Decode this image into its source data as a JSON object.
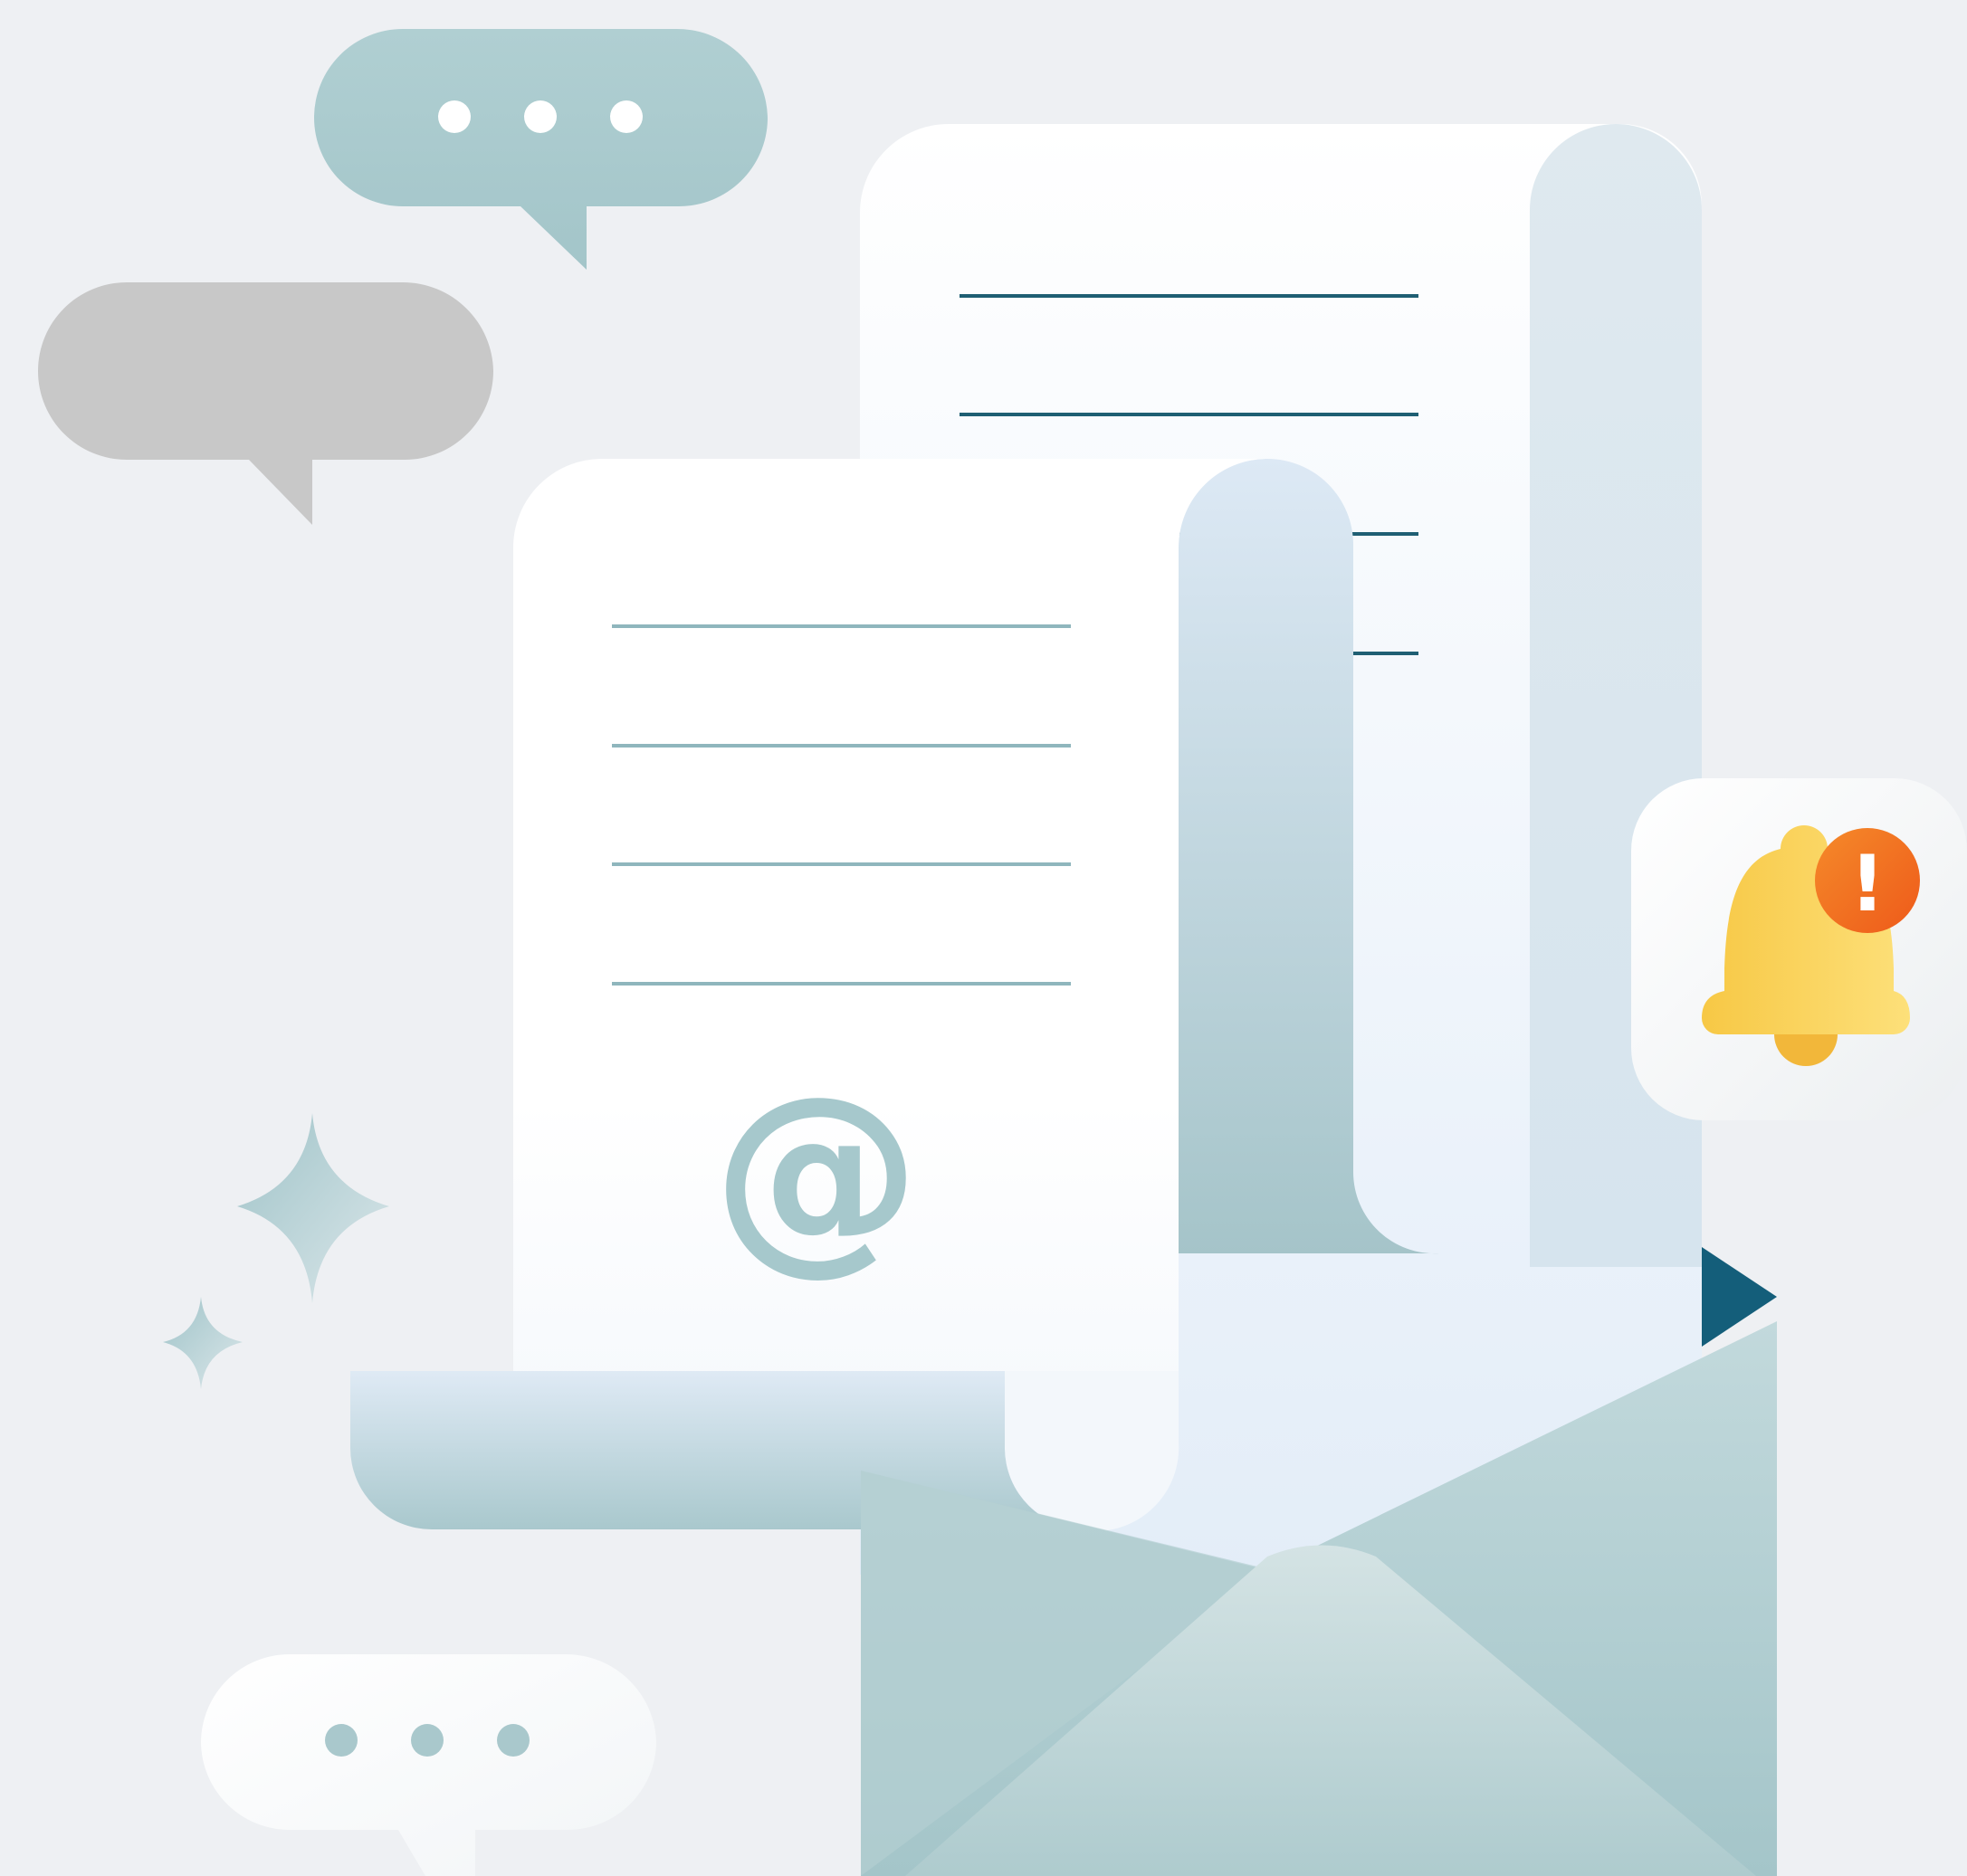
{
  "illustration": {
    "envelope_symbol": "@",
    "alert_symbol": "!",
    "icons": {
      "chat_bubble_top": "chat-bubble-typing-icon",
      "chat_bubble_middle": "chat-bubble-icon",
      "chat_bubble_bottom": "chat-bubble-typing-icon",
      "notification": "bell-alert-icon",
      "mail": "open-envelope-icon",
      "sparkle": "sparkle-icon"
    },
    "colors": {
      "background": "#eef0f3",
      "teal_accent": "#a9c9cc",
      "dark_teal_line": "#1f5f73",
      "envelope_arrow": "#145e7a",
      "bell_yellow": "#f6c544",
      "alert_orange": "#f36f21",
      "gray_bubble": "#c8c8c8"
    }
  }
}
